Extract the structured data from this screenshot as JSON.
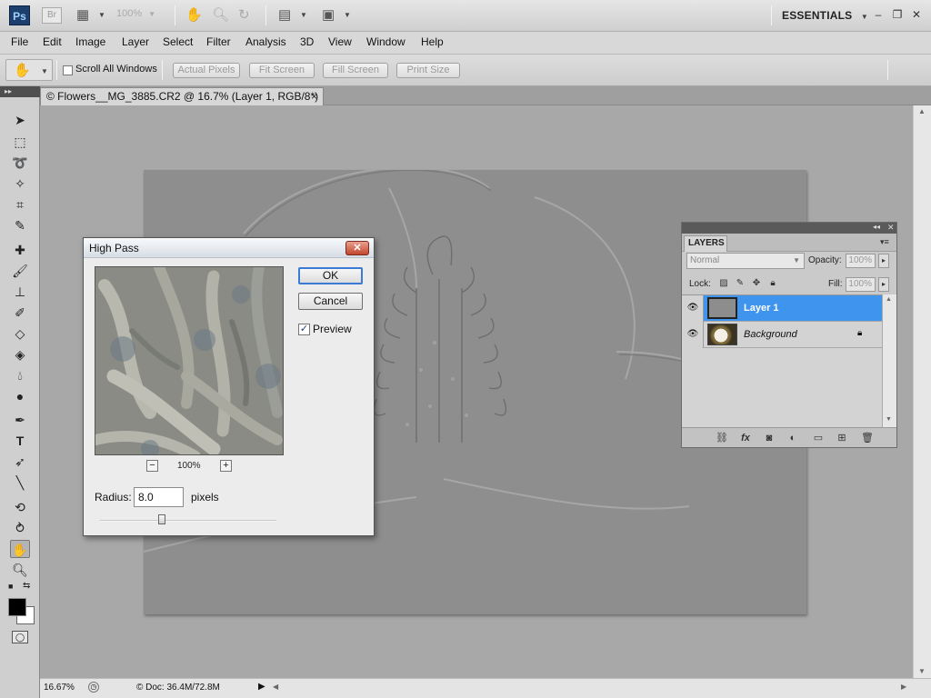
{
  "app": {
    "logo": "Ps",
    "bridge": "Br",
    "zoom_value": "100%",
    "workspace": "ESSENTIALS"
  },
  "menu": [
    "File",
    "Edit",
    "Image",
    "Layer",
    "Select",
    "Filter",
    "Analysis",
    "3D",
    "View",
    "Window",
    "Help"
  ],
  "options": {
    "scroll_all_windows": "Scroll All Windows",
    "buttons": [
      "Actual Pixels",
      "Fit Screen",
      "Fill Screen",
      "Print Size"
    ]
  },
  "document": {
    "tab_title": "© Flowers__MG_3885.CR2 @ 16.7% (Layer 1, RGB/8*) *",
    "close": "×"
  },
  "statusbar": {
    "zoom": "16.67%",
    "doc_info": "© Doc: 36.4M/72.8M"
  },
  "dialog": {
    "title": "High Pass",
    "close": "✕",
    "ok": "OK",
    "cancel": "Cancel",
    "preview_label": "Preview",
    "preview_checked": "✓",
    "zoom_out": "−",
    "zoom_in": "+",
    "zoom_pct": "100%",
    "radius_label": "Radius:",
    "radius_value": "8.0",
    "radius_unit": "pixels"
  },
  "layers_panel": {
    "tab": "LAYERS",
    "blend_mode": "Normal",
    "opacity_label": "Opacity:",
    "opacity_value": "100%",
    "lock_label": "Lock:",
    "fill_label": "Fill:",
    "fill_value": "100%",
    "layers": [
      {
        "name": "Layer 1",
        "active": true
      },
      {
        "name": "Background",
        "active": false
      }
    ]
  },
  "colors": {
    "accent": "#3f95ee",
    "canvas": "#8e8e8e",
    "workspace": "#a8a8a8"
  }
}
